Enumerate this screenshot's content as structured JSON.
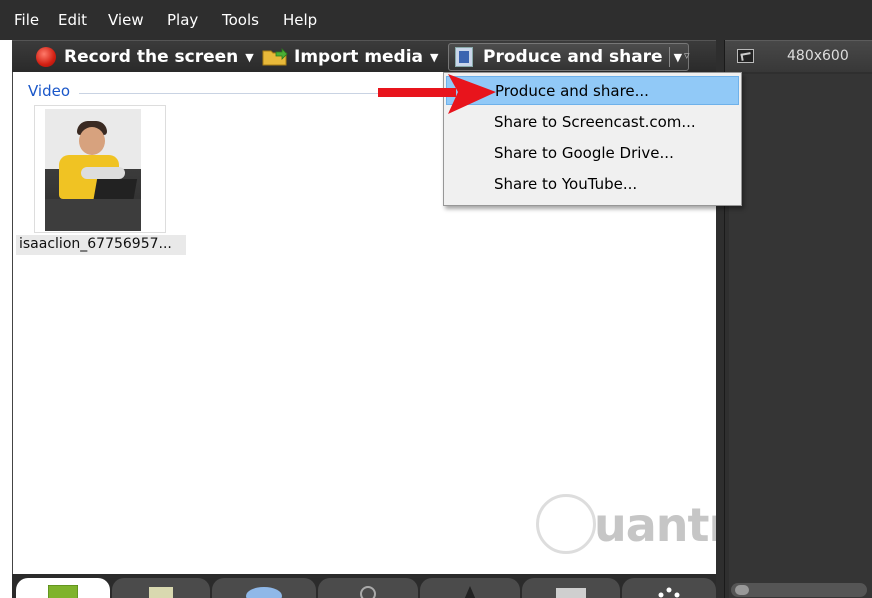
{
  "menu": {
    "items": [
      "File",
      "Edit",
      "View",
      "Play",
      "Tools",
      "Help"
    ]
  },
  "toolbar": {
    "record_label": "Record the screen",
    "import_label": "Import media",
    "produce_label": "Produce and share",
    "caret": "▼",
    "overflow": "▿"
  },
  "clip_bin": {
    "section_label": "Video",
    "clip_name": "isaaclion_67756957..."
  },
  "dropdown": {
    "items": [
      "Produce and share...",
      "Share to Screencast.com...",
      "Share to Google Drive...",
      "Share to YouTube..."
    ],
    "highlighted_index": 0
  },
  "preview": {
    "resolution": "480x600"
  },
  "watermark": {
    "text": "uantrimang"
  },
  "colors": {
    "menu_bg": "#2e2e2e",
    "accent_blue": "#1a57c9",
    "highlight": "#91c9f7",
    "arrow_red": "#e8141c"
  }
}
